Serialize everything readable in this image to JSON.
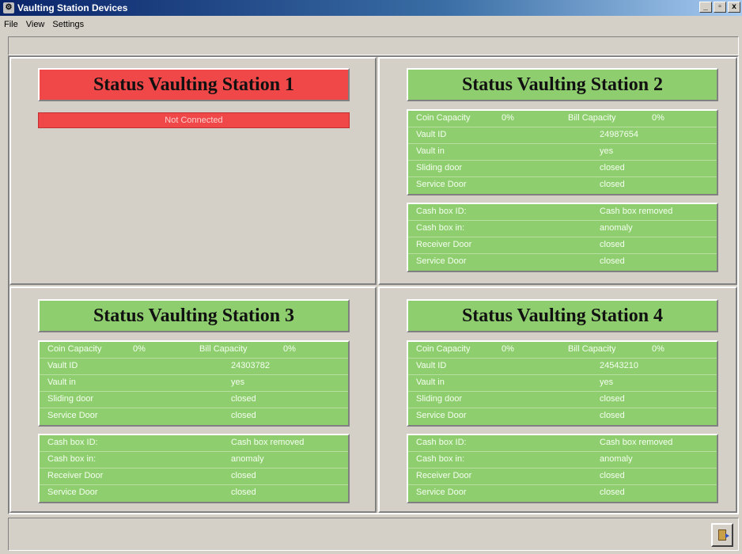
{
  "window": {
    "title": "Vaulting Station Devices",
    "min": "_",
    "max": "▫",
    "close": "x",
    "app_icon": "vault-app-icon"
  },
  "menu": {
    "file": "File",
    "view": "View",
    "settings": "Settings"
  },
  "colors": {
    "ok": "#8fce6f",
    "error": "#f04848"
  },
  "station1": {
    "title": "Status Vaulting Station 1",
    "status": "Not Connected"
  },
  "station2": {
    "title": "Status Vaulting Station 2",
    "coin_label": "Coin Capacity",
    "coin_value": "0%",
    "bill_label": "Bill Capacity",
    "bill_value": "0%",
    "vault": [
      {
        "label": "Vault ID",
        "value": "24987654"
      },
      {
        "label": "Vault in",
        "value": "yes"
      },
      {
        "label": "Sliding door",
        "value": "closed"
      },
      {
        "label": "Service Door",
        "value": "closed"
      }
    ],
    "cash": [
      {
        "label": "Cash box ID:",
        "value": "Cash box removed"
      },
      {
        "label": "Cash box in:",
        "value": "anomaly"
      },
      {
        "label": "Receiver Door",
        "value": "closed"
      },
      {
        "label": "Service Door",
        "value": "closed"
      }
    ]
  },
  "station3": {
    "title": "Status Vaulting Station 3",
    "coin_label": "Coin Capacity",
    "coin_value": "0%",
    "bill_label": "Bill Capacity",
    "bill_value": "0%",
    "vault": [
      {
        "label": "Vault ID",
        "value": "24303782"
      },
      {
        "label": "Vault in",
        "value": "yes"
      },
      {
        "label": "Sliding door",
        "value": "closed"
      },
      {
        "label": "Service Door",
        "value": "closed"
      }
    ],
    "cash": [
      {
        "label": "Cash box ID:",
        "value": "Cash box removed"
      },
      {
        "label": "Cash box in:",
        "value": "anomaly"
      },
      {
        "label": "Receiver Door",
        "value": "closed"
      },
      {
        "label": "Service Door",
        "value": "closed"
      }
    ]
  },
  "station4": {
    "title": "Status Vaulting Station 4",
    "coin_label": "Coin Capacity",
    "coin_value": "0%",
    "bill_label": "Bill Capacity",
    "bill_value": "0%",
    "vault": [
      {
        "label": "Vault ID",
        "value": "24543210"
      },
      {
        "label": "Vault in",
        "value": "yes"
      },
      {
        "label": "Sliding door",
        "value": "closed"
      },
      {
        "label": "Service Door",
        "value": "closed"
      }
    ],
    "cash": [
      {
        "label": "Cash box ID:",
        "value": "Cash box removed"
      },
      {
        "label": "Cash box in:",
        "value": "anomaly"
      },
      {
        "label": "Receiver Door",
        "value": "closed"
      },
      {
        "label": "Service Door",
        "value": "closed"
      }
    ]
  },
  "statusbar": {
    "exit_icon": "exit-door-icon"
  }
}
